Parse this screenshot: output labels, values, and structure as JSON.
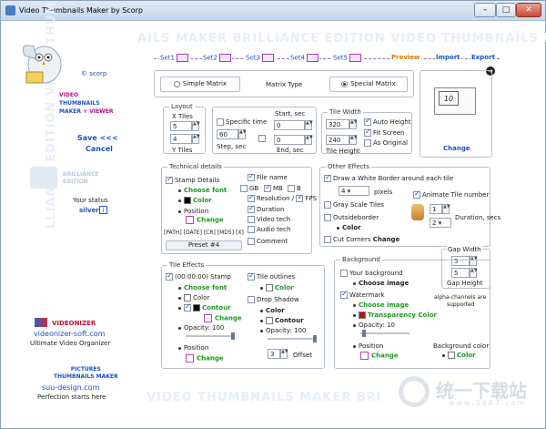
{
  "window": {
    "title": "Video Thumbnails Maker by Scorp",
    "min": "–",
    "max": "□",
    "close": "✕"
  },
  "watermark": {
    "line1": "AILS MAKER BRILLIANCE EDITION VIDEO THUMBNAILS M",
    "line2": "VIDEO THUMBNAILS MAKER BRI",
    "line3": "LLIANCE EDITION VIDEO THUM"
  },
  "sidebar": {
    "brand": "© scorp",
    "product_line1": "VIDEO",
    "product_line2": "THUMBNAILS",
    "product_line3": "MAKER",
    "product_plus": "+",
    "product_viewer": "VIEWER",
    "save": "Save <<<",
    "cancel": "Cancel",
    "edition_line1": "BRILLIANCE",
    "edition_line2": "EDITION",
    "status_label": "Your status",
    "status_value": "silver",
    "status_info": "i",
    "videonizer_name": "VIDEONIZER",
    "videonizer_url": "videonizer-soft.com",
    "videonizer_tag": "Ultimate Video Organizer",
    "pm_line1": "PICTURES",
    "pm_line2": "THUMBNAILS MAKER",
    "pm_url": "suu-design.com",
    "pm_tag": "Perfection starts here"
  },
  "steps": [
    "Set1",
    "Set2",
    "Set3",
    "Set4",
    "Set5",
    "Preview",
    "Import",
    "Export"
  ],
  "matrix": {
    "simple": "Simple Matrix",
    "type_label": "Matrix Type",
    "special": "Special Matrix",
    "preview_number": "10",
    "change": "Change"
  },
  "layout": {
    "legend": "Layout",
    "x_tiles": "X Tiles",
    "x_value": "5",
    "y_value": "4",
    "y_tiles": "Y Tiles"
  },
  "time": {
    "specific": "Specific time",
    "start": "Start, sec",
    "step_value": "60",
    "start_value": "0",
    "step": "Step, sec",
    "end_value": "0",
    "end": "End, sec"
  },
  "tilewidth": {
    "legend": "Tile Width",
    "width_value": "320",
    "height_value": "240",
    "auto_height": "Auto Height",
    "fit_screen": "Fit Screen",
    "as_original": "As Original",
    "tile_height": "Tile Height"
  },
  "technical": {
    "legend": "Technical details",
    "stamp": "Stamp Details",
    "choose_font": "Choose font",
    "color": "Color",
    "position": "Position",
    "change": "Change",
    "file_name": "File name",
    "gb": "GB",
    "mb": "MB",
    "b": "B",
    "resolution": "Resolution",
    "fps": "FPS",
    "duration": "Duration",
    "video_tech": "Video tech",
    "audio_tech": "Audio tech",
    "comment": "Comment",
    "tokens": "[PATH] [DATE] [CR] [MD5] [X]",
    "preset": "Preset #4"
  },
  "other": {
    "legend": "Other Effects",
    "white_border": "Draw a White Border around each tile",
    "pixels_value": "4",
    "pixels": "pixels",
    "gray_scale": "Gray Scale Tiles",
    "outsideborder": "Outsideborder",
    "color": "Color",
    "cut_corners": "Cut Corners",
    "change": "Change",
    "animate": "Animate Tile number",
    "num_value": "1",
    "dur_value": "2",
    "duration": "Duration, secs"
  },
  "gap": {
    "width_label": "Gap Width",
    "w_value": "5",
    "h_value": "5",
    "height_label": "Gap Height",
    "alpha_note_1": "alpha-channels are",
    "alpha_note_2": "supported"
  },
  "tile_effects": {
    "legend": "Tile Effects",
    "stamp": "(00:00:00) Stamp",
    "choose_font": "Choose font",
    "color": "Color",
    "contour": "Contour",
    "change": "Change",
    "opacity": "Opacity: 100",
    "position": "Position",
    "outlines": "Tile outlines",
    "drop_shadow": "Drop Shadow",
    "shadow_color": "Color",
    "shadow_contour": "Contour",
    "shadow_opacity": "Opacity: 100",
    "offset_value": "3",
    "offset": "Offset"
  },
  "background": {
    "legend": "Background",
    "your_bg": "Your background",
    "choose_image": "Choose image",
    "watermark": "Watermark",
    "wm_choose": "Choose image",
    "transparency": "Transparency Color",
    "opacity": "Opacity: 10",
    "position": "Position",
    "change": "Change",
    "bg_color_label": "Background color",
    "bg_color": "Color"
  },
  "corner": {
    "site_cn": "统一下载站",
    "site_url": "www.3987.com"
  }
}
